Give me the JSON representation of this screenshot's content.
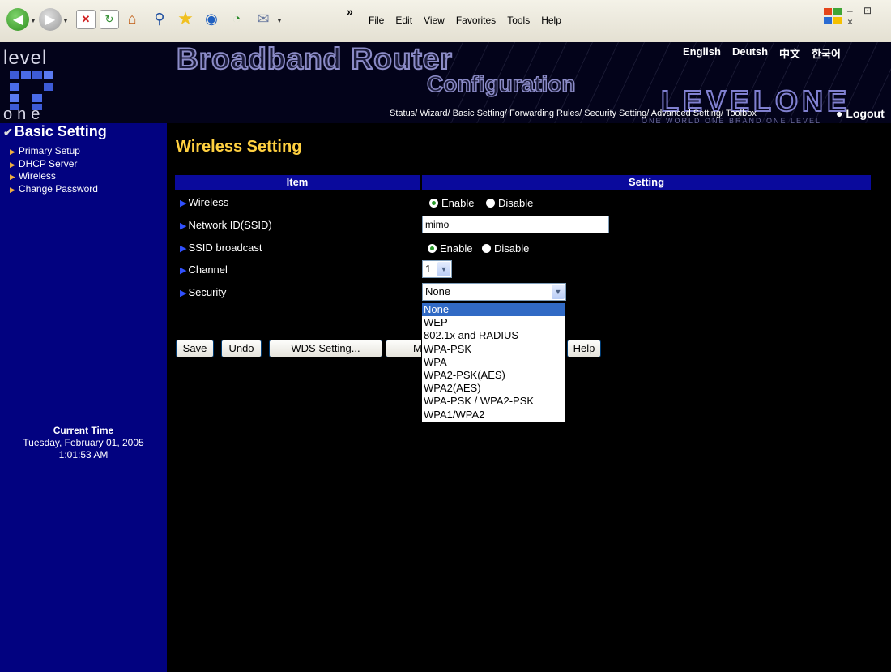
{
  "browser": {
    "menu": [
      "File",
      "Edit",
      "View",
      "Favorites",
      "Tools",
      "Help"
    ],
    "toolbar_icons": [
      "back-icon",
      "forward-icon",
      "stop-icon",
      "refresh-icon",
      "home-icon",
      "search-icon",
      "favorites-icon",
      "media-icon",
      "history-icon",
      "mail-icon"
    ],
    "window_controls": "– ⊡ ×"
  },
  "header": {
    "logo_top": "level",
    "logo_bottom": "one",
    "title_line1": "Broadband Router",
    "title_line2": "Configuration",
    "brand": "LEVELONE",
    "tagline": "ONE WORLD  ONE BRAND  ONE LEVEL",
    "languages": [
      "English",
      "Deutsh",
      "中文",
      "한국어"
    ],
    "nav_links": "Status/ Wizard/ Basic Setting/ Forwarding Rules/ Security Setting/ Advanced Setting/ Toolbox",
    "logout": "● Logout"
  },
  "sidebar": {
    "title": "Basic Setting",
    "items": [
      "Primary Setup",
      "DHCP Server",
      "Wireless",
      "Change Password"
    ],
    "time_label": "Current Time",
    "time_date": "Tuesday, February 01, 2005",
    "time_clock": "1:01:53 AM"
  },
  "main": {
    "title": "Wireless Setting",
    "col_item": "Item",
    "col_setting": "Setting",
    "rows": {
      "wireless": {
        "label": "Wireless",
        "opt_enable": "Enable",
        "opt_disable": "Disable",
        "selected": "Enable"
      },
      "ssid": {
        "label": "Network ID(SSID)",
        "value": "mimo"
      },
      "broadcast": {
        "label": "SSID broadcast",
        "opt_enable": "Enable",
        "opt_disable": "Disable",
        "selected": "Enable"
      },
      "channel": {
        "label": "Channel",
        "value": "1"
      },
      "security": {
        "label": "Security",
        "value": "None"
      }
    },
    "security_options": [
      "None",
      "WEP",
      "802.1x and RADIUS",
      "WPA-PSK",
      "WPA",
      "WPA2-PSK(AES)",
      "WPA2(AES)",
      "WPA-PSK / WPA2-PSK",
      "WPA1/WPA2"
    ],
    "buttons": {
      "save": "Save",
      "undo": "Undo",
      "wds": "WDS Setting...",
      "mac_partial": "M",
      "help": "Help"
    }
  },
  "colors": {
    "sidebar_bg": "#020280",
    "table_header": "#0a0a9c",
    "title": "#ffd040",
    "dropdown_highlight": "#316ac5"
  }
}
